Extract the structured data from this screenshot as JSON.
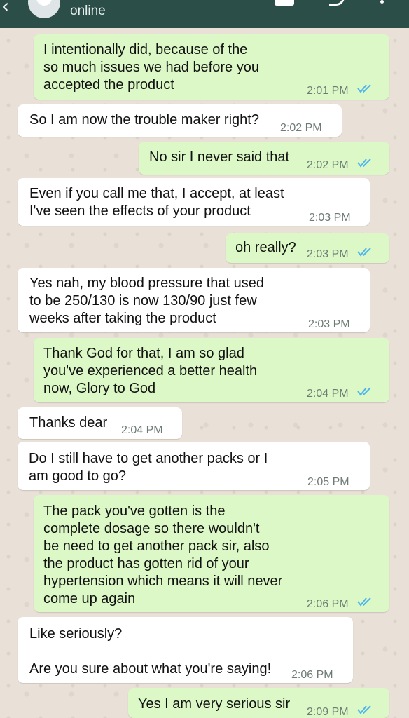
{
  "header": {
    "status": "online"
  },
  "colors": {
    "header_bg": "#2c4e49",
    "incoming_bubble": "#ffffff",
    "outgoing_bubble": "#dcf8c6",
    "read_ticks": "#4fb6ec",
    "timestamp": "#6e7b74"
  },
  "messages": [
    {
      "direction": "out",
      "text": "I intentionally did, because of the\nso much issues we had before you\naccepted the product",
      "time": "2:01 PM",
      "read": true
    },
    {
      "direction": "in",
      "text": "So I am now the trouble maker right?",
      "time": "2:02 PM"
    },
    {
      "direction": "out",
      "text": "No sir I never said that",
      "time": "2:02 PM",
      "read": true
    },
    {
      "direction": "in",
      "text": "Even if you call me that, I accept, at least\nI've seen the effects of your product",
      "time": "2:03 PM"
    },
    {
      "direction": "out",
      "text": "oh really?",
      "time": "2:03 PM",
      "read": true
    },
    {
      "direction": "in",
      "text": "Yes nah, my blood pressure that used\nto be 250/130 is now 130/90 just few\nweeks after taking the product",
      "time": "2:03 PM"
    },
    {
      "direction": "out",
      "text": "Thank God for that, I am so glad\nyou've experienced a better health\nnow, Glory to God",
      "time": "2:04 PM",
      "read": true
    },
    {
      "direction": "in",
      "text": "Thanks dear",
      "time": "2:04 PM"
    },
    {
      "direction": "in",
      "text": "Do I still have to get another packs or I\nam good to go?",
      "time": "2:05 PM"
    },
    {
      "direction": "out",
      "text": "The pack you've gotten is the\ncomplete dosage so there wouldn't\nbe need to get another pack sir, also\nthe product has gotten rid of your\nhypertension which means it will never\ncome up again",
      "time": "2:06 PM",
      "read": true
    },
    {
      "direction": "in",
      "text": "Like seriously?\n\nAre you sure about what you're saying!",
      "time": "2:06 PM"
    },
    {
      "direction": "out",
      "text": "Yes I am very serious sir",
      "time": "2:09 PM",
      "read": true
    }
  ]
}
